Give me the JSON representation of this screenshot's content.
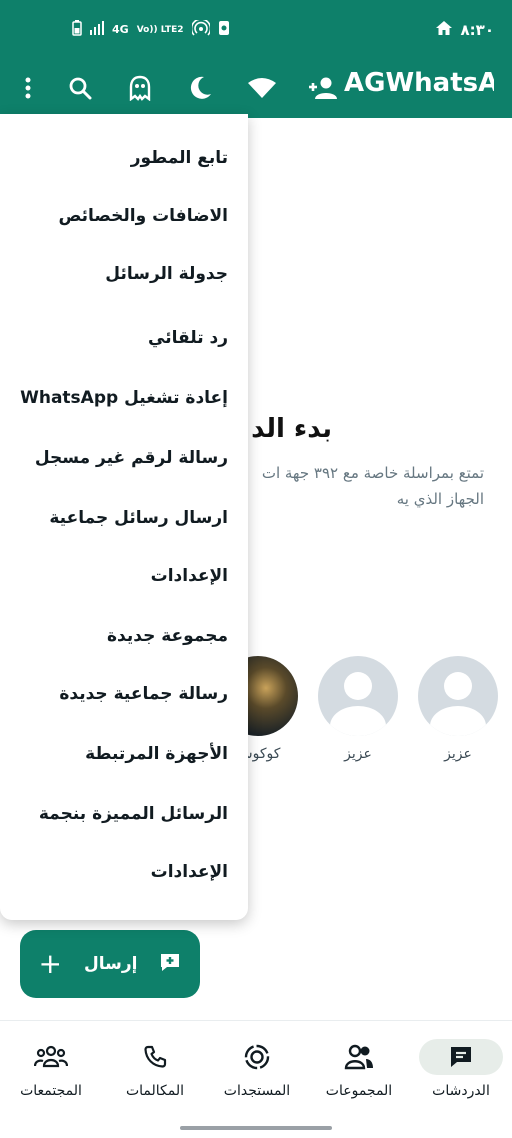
{
  "status_bar": {
    "time": "٨:٣٠",
    "network_label": "4G",
    "volte_label": "Vo)) LTE2"
  },
  "app_bar": {
    "title": "AGWhatsA"
  },
  "menu": {
    "items": [
      "تابع المطور",
      "الاضافات والخصائص",
      "جدولة الرسائل",
      "رد تلقائي",
      "إعادة تشغيل WhatsApp",
      "رسالة لرقم غير مسجل",
      "ارسال رسائل جماعية",
      "الإعدادات",
      "مجموعة جديدة",
      "رسالة جماعية جديدة",
      "الأجهزة المرتبطة",
      "الرسائل المميزة بنجمة",
      "الإعدادات"
    ]
  },
  "content": {
    "start_title": "بدء الد",
    "start_desc_line1": "تمتع بمراسلة خاصة مع ٣٩٢ جهة ات",
    "start_desc_line2": "الجهاز الذي يه",
    "contacts": [
      {
        "name": "عزيز"
      },
      {
        "name": "عزيز"
      },
      {
        "name": "كوكوس"
      }
    ]
  },
  "fab": {
    "label": "إرسال",
    "plus": "+"
  },
  "bottom_nav": {
    "items": [
      {
        "label": "الدردشات",
        "icon": "chat-icon",
        "active": true
      },
      {
        "label": "المجموعات",
        "icon": "groups-icon",
        "active": false
      },
      {
        "label": "المستجدات",
        "icon": "status-icon",
        "active": false
      },
      {
        "label": "المكالمات",
        "icon": "phone-icon",
        "active": false
      },
      {
        "label": "المجتمعات",
        "icon": "communities-icon",
        "active": false
      }
    ]
  },
  "colors": {
    "brand": "#0e806a",
    "active_pill": "#e7ede9"
  }
}
